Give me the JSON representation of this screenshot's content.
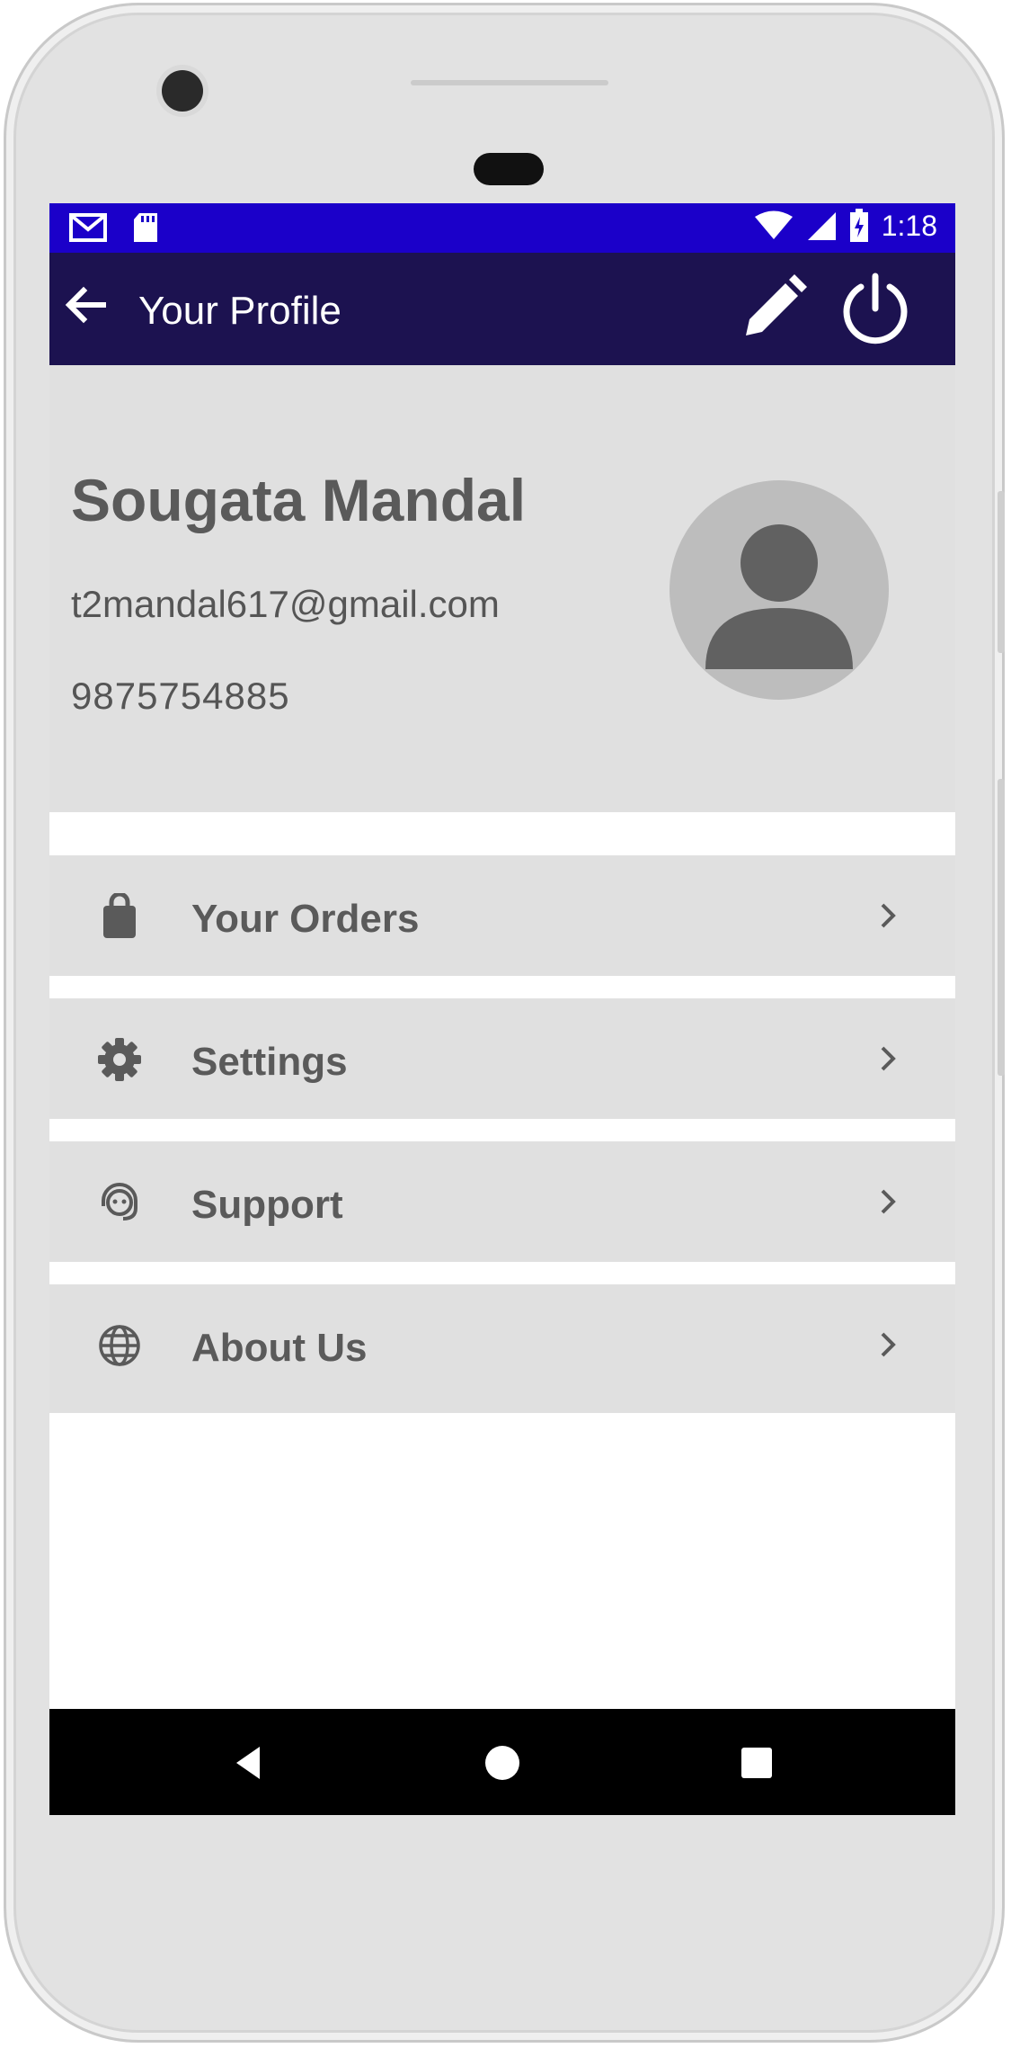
{
  "status_bar": {
    "time": "1:18",
    "left_icons": [
      "gmail-icon",
      "sd-card-icon"
    ],
    "right_icons": [
      "wifi-icon",
      "signal-icon",
      "battery-icon"
    ]
  },
  "app_bar": {
    "title": "Your Profile",
    "back_icon": "arrow-back-icon",
    "actions": [
      "edit-icon",
      "power-icon"
    ],
    "background": "#1c1250"
  },
  "profile": {
    "name": "Sougata Mandal",
    "email": "t2mandal617@gmail.com",
    "phone": "9875754885",
    "avatar_icon": "person-icon"
  },
  "menu": {
    "items": [
      {
        "label": "Your Orders",
        "icon": "shopping-bag-icon"
      },
      {
        "label": "Settings",
        "icon": "gear-icon"
      },
      {
        "label": "Support",
        "icon": "support-agent-icon"
      },
      {
        "label": "About Us",
        "icon": "globe-icon"
      }
    ]
  },
  "colors": {
    "status_bar": "#1b00c9",
    "app_bar": "#1c1250",
    "screen_bg": "#e0e0e0",
    "text": "#5a5a5a"
  }
}
